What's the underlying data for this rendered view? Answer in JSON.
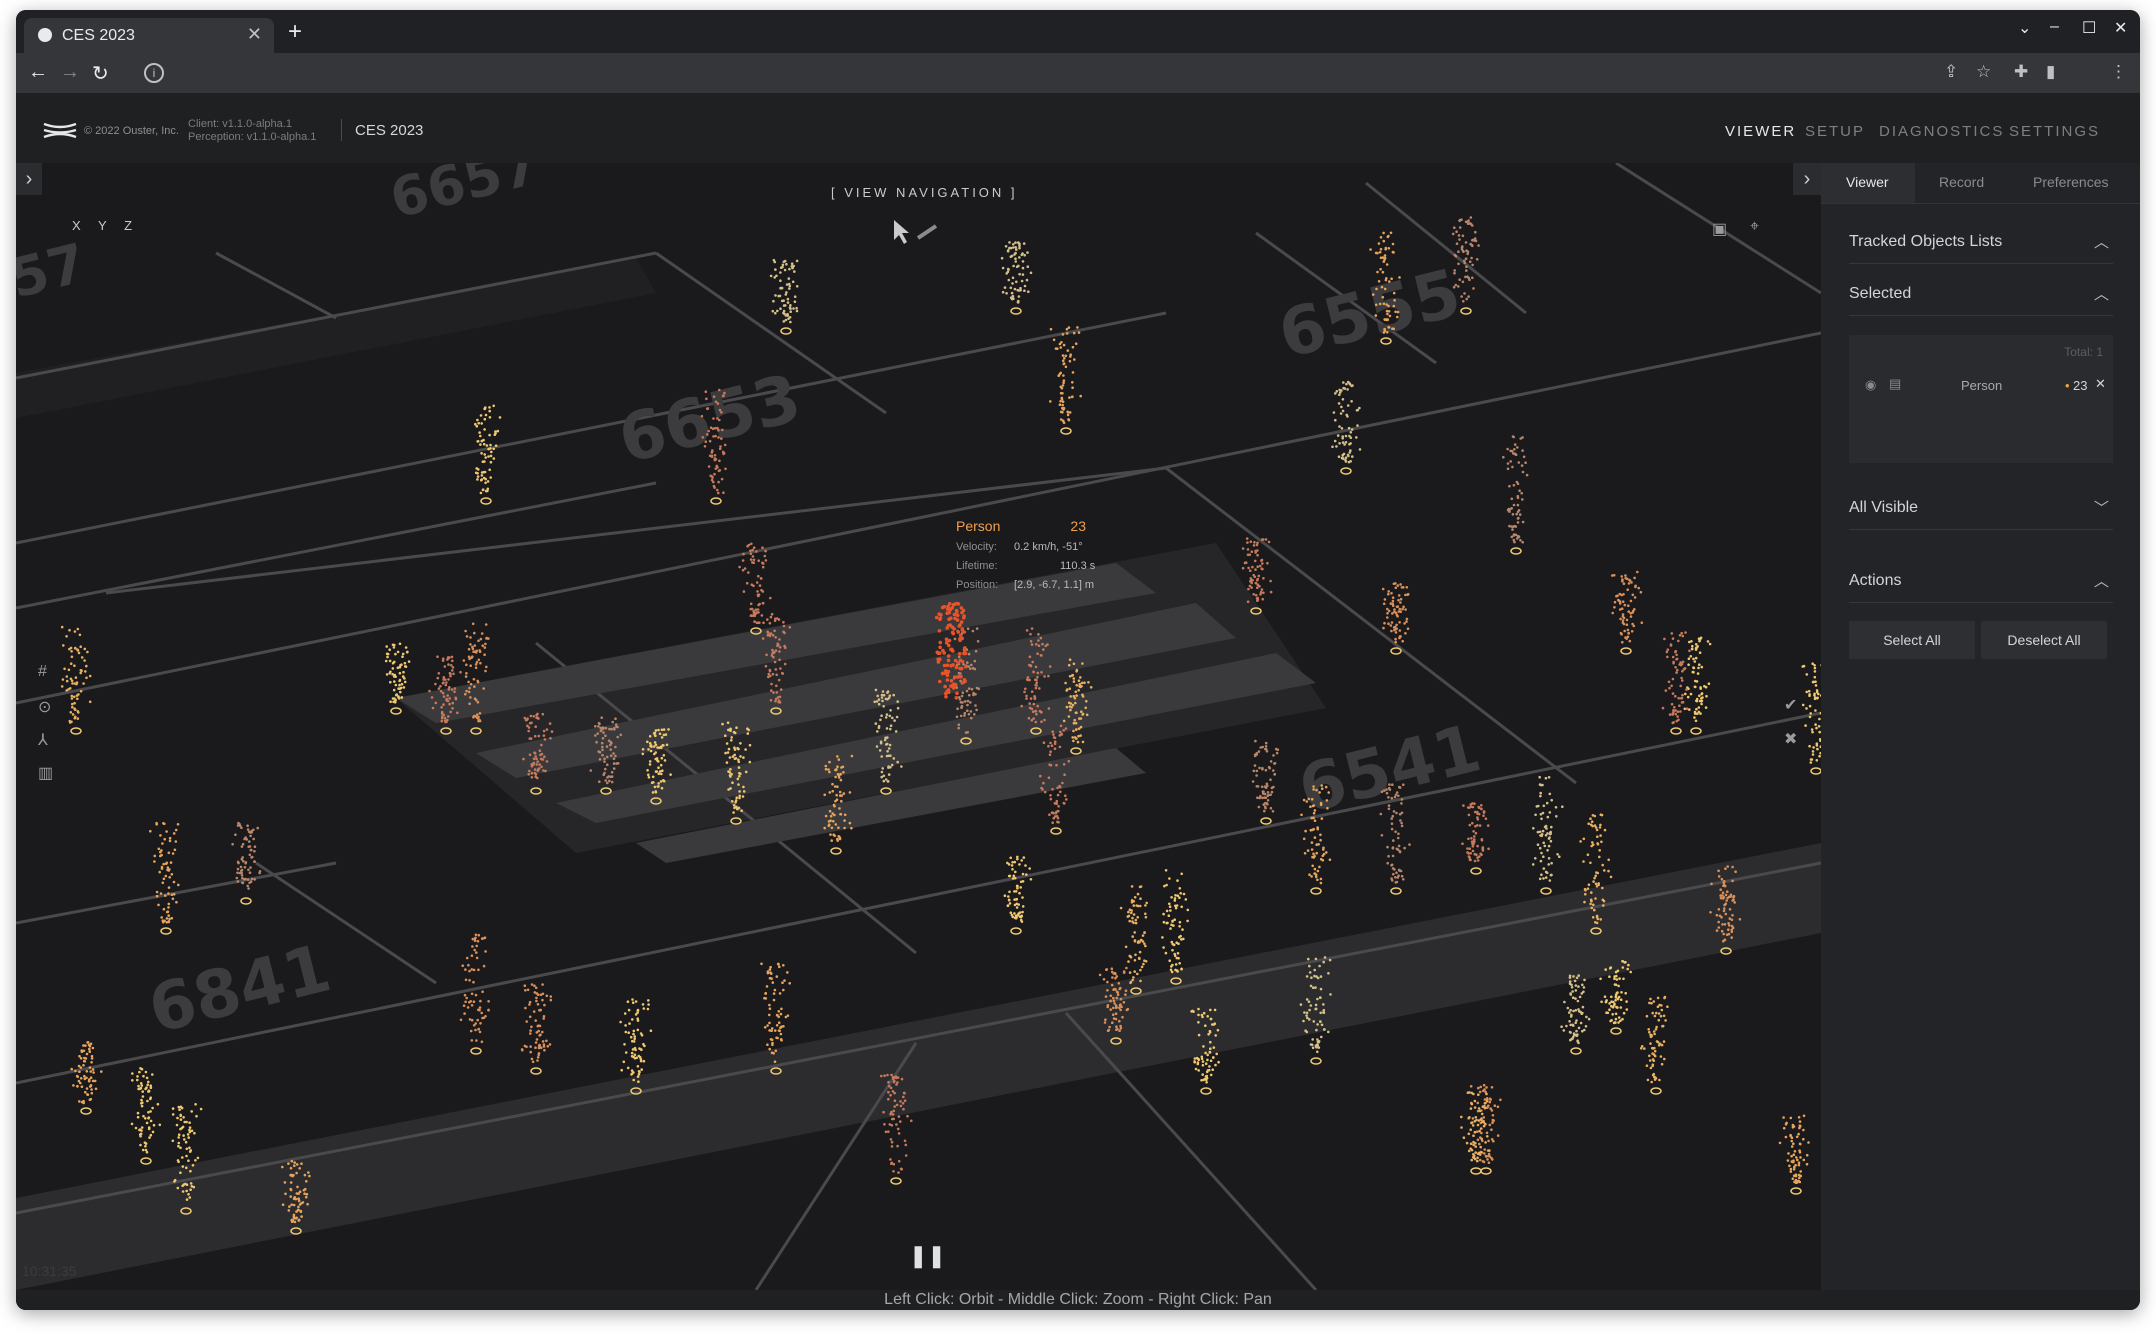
{
  "browser": {
    "tab_title": "CES 2023",
    "tab_close": "✕",
    "new_tab": "+"
  },
  "app": {
    "copyright": "© 2022 Ouster, Inc.",
    "client_version": "Client: v1.1.0-alpha.1",
    "perception_version": "Perception: v1.1.0-alpha.1",
    "project_name": "CES 2023",
    "nav": [
      "VIEWER",
      "SETUP",
      "DIAGNOSTICS",
      "SETTINGS"
    ],
    "active_nav": "VIEWER"
  },
  "viewer": {
    "view_navigation": "[ VIEW NAVIGATION ]",
    "axes": "X Y Z",
    "clock": "10:31:35",
    "street_numbers": [
      "6657",
      "6653",
      "6555",
      "6841",
      "6541",
      "57"
    ],
    "tooltip": {
      "class": "Person",
      "id": "23",
      "velocity_label": "Velocity:",
      "velocity": "0.2 km/h, -51°",
      "lifetime_label": "Lifetime:",
      "lifetime": "110.3 s",
      "position_label": "Position:",
      "position": "[2.9, -6.7, 1.1] m"
    },
    "status_hint": "Left Click: Orbit - Middle Click: Zoom - Right Click: Pan",
    "accent_color": "#f0a04b",
    "selected_color": "#e8532a"
  },
  "panel": {
    "tabs": [
      "Viewer",
      "Record",
      "Preferences"
    ],
    "active_tab": "Viewer",
    "tracked_lists": "Tracked Objects Lists",
    "selected": "Selected",
    "total": "Total: 1",
    "selected_item": {
      "class": "Person",
      "id": "23"
    },
    "all_visible": "All Visible",
    "actions": "Actions",
    "select_all": "Select All",
    "deselect_all": "Deselect All"
  }
}
